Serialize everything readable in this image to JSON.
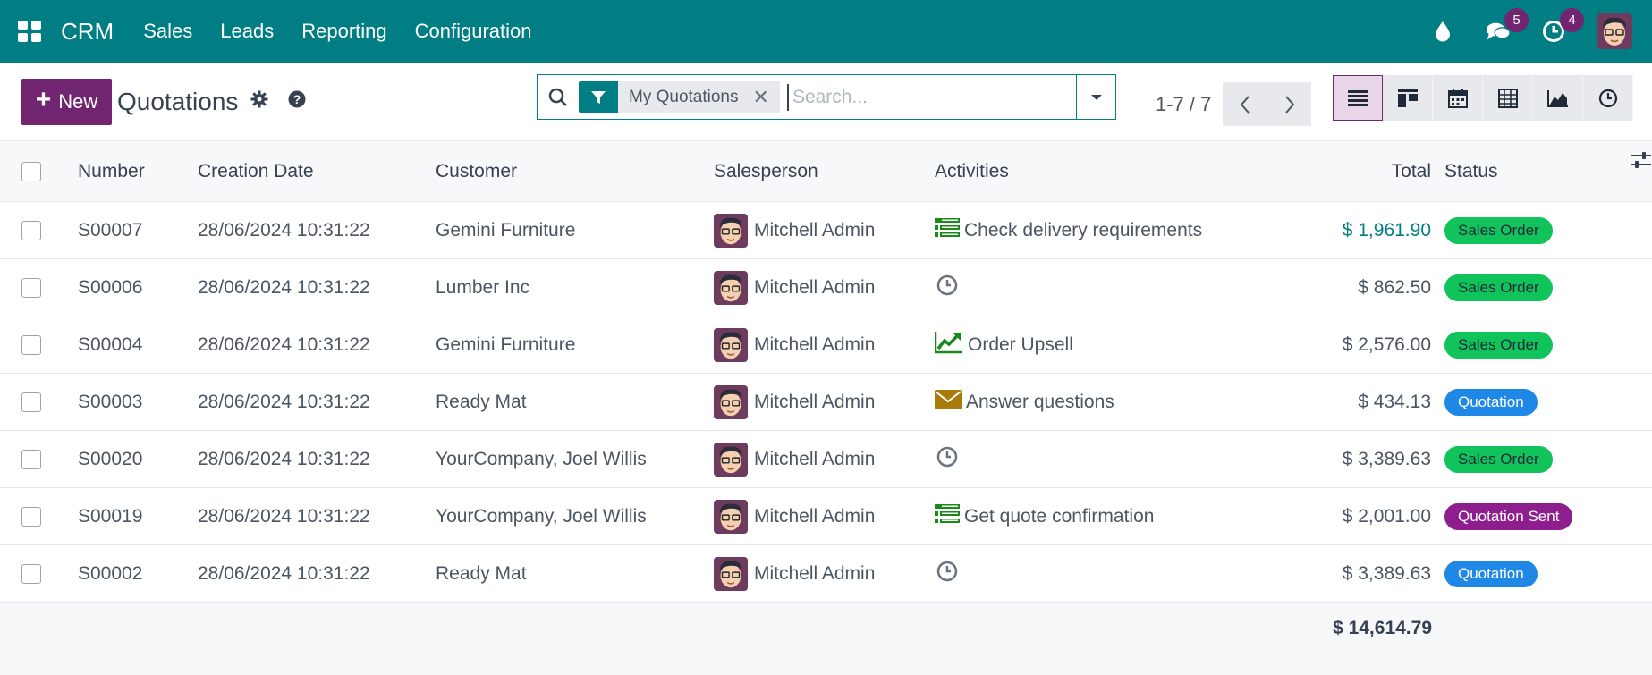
{
  "navbar": {
    "app_name": "CRM",
    "menu": [
      "Sales",
      "Leads",
      "Reporting",
      "Configuration"
    ],
    "messages_count": "5",
    "activities_count": "4"
  },
  "control": {
    "new_label": "New",
    "title": "Quotations",
    "facet_label": "My Quotations",
    "search_placeholder": "Search...",
    "pager": "1-7 / 7"
  },
  "table": {
    "headers": {
      "number": "Number",
      "date": "Creation Date",
      "customer": "Customer",
      "salesperson": "Salesperson",
      "activities": "Activities",
      "total": "Total",
      "status": "Status"
    },
    "rows": [
      {
        "number": "S00007",
        "date": "28/06/2024 10:31:22",
        "customer": "Gemini Furniture",
        "salesperson": "Mitchell Admin",
        "activity_icon": "todo-list-icon",
        "activity": "Check delivery requirements",
        "total": "$ 1,961.90",
        "status": "Sales Order",
        "status_color": "green"
      },
      {
        "number": "S00006",
        "date": "28/06/2024 10:31:22",
        "customer": "Lumber Inc",
        "salesperson": "Mitchell Admin",
        "activity_icon": "clock-icon",
        "activity": "",
        "total": "$ 862.50",
        "status": "Sales Order",
        "status_color": "green"
      },
      {
        "number": "S00004",
        "date": "28/06/2024 10:31:22",
        "customer": "Gemini Furniture",
        "salesperson": "Mitchell Admin",
        "activity_icon": "trend-chart-icon",
        "activity": "Order Upsell",
        "total": "$ 2,576.00",
        "status": "Sales Order",
        "status_color": "green"
      },
      {
        "number": "S00003",
        "date": "28/06/2024 10:31:22",
        "customer": "Ready Mat",
        "salesperson": "Mitchell Admin",
        "activity_icon": "envelope-icon",
        "activity": "Answer questions",
        "total": "$ 434.13",
        "status": "Quotation",
        "status_color": "blue"
      },
      {
        "number": "S00020",
        "date": "28/06/2024 10:31:22",
        "customer": "YourCompany, Joel Willis",
        "salesperson": "Mitchell Admin",
        "activity_icon": "clock-icon",
        "activity": "",
        "total": "$ 3,389.63",
        "status": "Sales Order",
        "status_color": "green"
      },
      {
        "number": "S00019",
        "date": "28/06/2024 10:31:22",
        "customer": "YourCompany, Joel Willis",
        "salesperson": "Mitchell Admin",
        "activity_icon": "todo-list-icon",
        "activity": "Get quote confirmation",
        "total": "$ 2,001.00",
        "status": "Quotation Sent",
        "status_color": "purple"
      },
      {
        "number": "S00002",
        "date": "28/06/2024 10:31:22",
        "customer": "Ready Mat",
        "salesperson": "Mitchell Admin",
        "activity_icon": "clock-icon",
        "activity": "",
        "total": "$ 3,389.63",
        "status": "Quotation",
        "status_color": "blue"
      }
    ],
    "grand_total": "$ 14,614.79"
  },
  "colors": {
    "navbar": "#017e84",
    "primary": "#71246f"
  }
}
